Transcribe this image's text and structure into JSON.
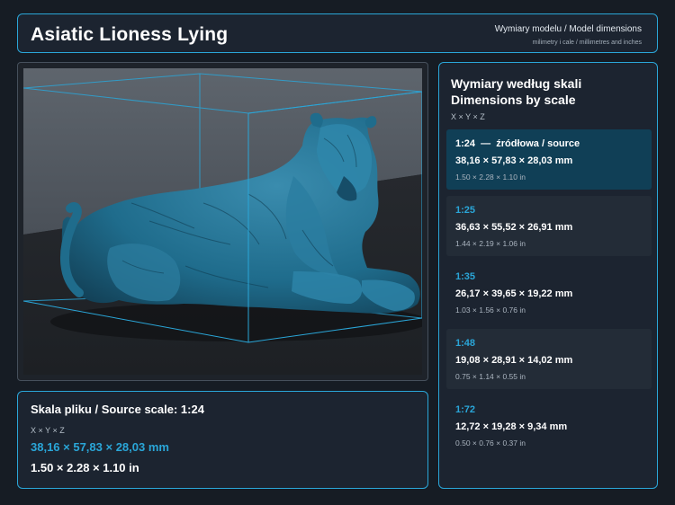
{
  "header": {
    "title": "Asiatic Lioness Lying",
    "subtitle_1": "Wymiary modelu / Model dimensions",
    "subtitle_2": "milimetry i cale / millimetres and inches"
  },
  "viewer": {
    "model": "lioness-model"
  },
  "source": {
    "title": "Skala pliku / Source scale: 1:24",
    "axes": "X × Y × Z",
    "mm": "38,16 × 57,83 × 28,03 mm",
    "inches": "1.50 × 2.28 × 1.10 in"
  },
  "scales": {
    "title_line1": "Wymiary według skali",
    "title_line2": "Dimensions by scale",
    "axes": "X × Y × Z",
    "items": [
      {
        "label": "1:24  —  źródłowa / source",
        "mm": "38,16 × 57,83 × 28,03 mm",
        "inches": "1.50 × 2.28 × 1.10 in"
      },
      {
        "label": "1:25",
        "mm": "36,63 × 55,52 × 26,91 mm",
        "inches": "1.44 × 2.19 × 1.06 in"
      },
      {
        "label": "1:35",
        "mm": "26,17 × 39,65 × 19,22 mm",
        "inches": "1.03 × 1.56 × 0.76 in"
      },
      {
        "label": "1:48",
        "mm": "19,08 × 28,91 × 14,02 mm",
        "inches": "0.75 × 1.14 × 0.55 in"
      },
      {
        "label": "1:72",
        "mm": "12,72 × 19,28 × 9,34 mm",
        "inches": "0.50 × 0.76 × 0.37 in"
      }
    ]
  },
  "colors": {
    "accent": "#2aa6d8",
    "background": "#161c24",
    "panel": "#1c2430",
    "active_row": "#103f56",
    "model": "#1f6c8c"
  }
}
